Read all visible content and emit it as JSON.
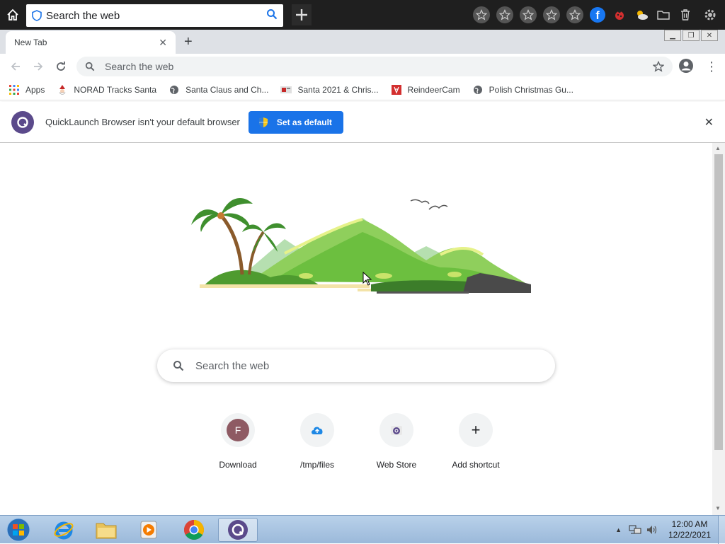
{
  "topbar": {
    "search_text": "Search the web"
  },
  "tab": {
    "title": "New Tab",
    "close": "✕",
    "new_tab": "+"
  },
  "omnibox": {
    "placeholder": "Search the web"
  },
  "bookmarks": [
    {
      "label": "Apps"
    },
    {
      "label": "NORAD Tracks Santa"
    },
    {
      "label": "Santa Claus and Ch..."
    },
    {
      "label": "Santa 2021 & Chris..."
    },
    {
      "label": "ReindeerCam"
    },
    {
      "label": "Polish Christmas Gu..."
    }
  ],
  "infobar": {
    "message": "QuickLaunch Browser isn't your default browser",
    "button": "Set as default",
    "close": "✕"
  },
  "ntp": {
    "search_placeholder": "Search the web",
    "shortcuts": [
      {
        "label": "Download",
        "icon": "letter-f-icon",
        "letter": "F"
      },
      {
        "label": "/tmp/files",
        "icon": "cloud-upload-icon"
      },
      {
        "label": "Web Store",
        "icon": "web-store-icon"
      },
      {
        "label": "Add shortcut",
        "icon": "plus-icon",
        "glyph": "+"
      }
    ]
  },
  "taskbar": {
    "time": "12:00 AM",
    "date": "12/22/2021"
  },
  "colors": {
    "accent": "#1a73e8",
    "brand": "#5b4a8b",
    "topbar": "#1f1f1f"
  }
}
